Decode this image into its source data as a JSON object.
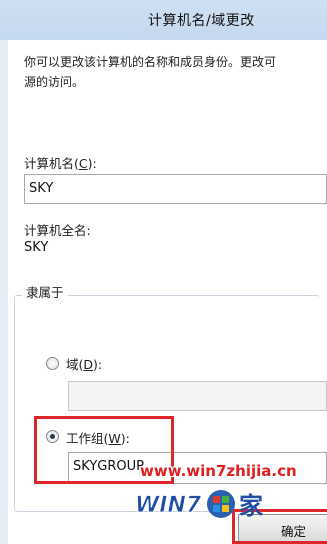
{
  "window": {
    "title": "计算机名/域更改"
  },
  "description": {
    "line1": "你可以更改该计算机的名称和成员身份。更改可",
    "line2": "源的访问。"
  },
  "computer_name": {
    "label": "计算机名",
    "accel": "C",
    "value": "SKY"
  },
  "full_name": {
    "label": "计算机全名:",
    "value": "SKY"
  },
  "member_of": {
    "label": "隶属于",
    "domain": {
      "label": "域",
      "accel": "D",
      "value": "",
      "selected": false
    },
    "workgroup": {
      "label": "工作组",
      "accel": "W",
      "value": "SKYGROUP",
      "selected": true
    }
  },
  "buttons": {
    "ok": "确定"
  },
  "watermark": {
    "url": "www.win7zhijia.cn",
    "brand": "WIN7",
    "brand_suffix": "家"
  },
  "colors": {
    "highlight": "#e0262b",
    "watermark": "#e02020"
  }
}
